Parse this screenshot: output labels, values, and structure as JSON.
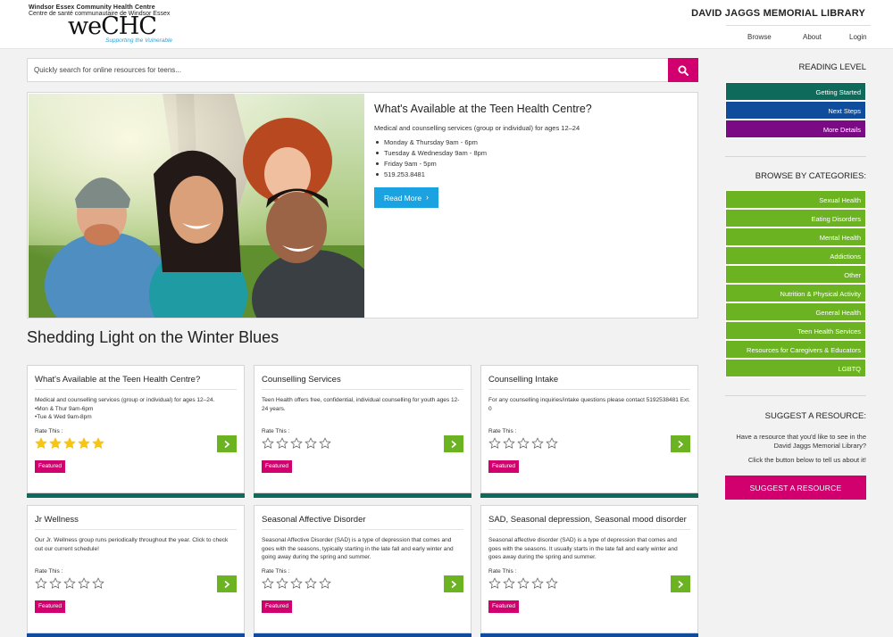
{
  "brand": {
    "org_line1": "Windsor Essex Community Health Centre",
    "org_line2": "Centre de santé communautaire de Windsor Essex",
    "logo_text": "weCHC",
    "tagline": "Supporting the Vulnerable"
  },
  "header": {
    "library_title": "DAVID JAGGS MEMORIAL LIBRARY",
    "nav": [
      "Browse",
      "About",
      "Login"
    ]
  },
  "search": {
    "placeholder": "Quickly search for online resources for teens..."
  },
  "hero": {
    "title": "What's Available at the Teen Health Centre?",
    "description": "Medical and counselling services (group or individual) for ages 12–24",
    "hours": [
      "Monday & Thursday 9am - 6pm",
      "Tuesday & Wednesday 9am - 8pm",
      "Friday 9am - 5pm",
      "519.253.8481"
    ],
    "button_label": "Read More",
    "image_description": "Four smiling young friends posing together outdoors"
  },
  "section_title": "Shedding Light on the Winter Blues",
  "cards": [
    {
      "title": "What's Available at the Teen Health Centre?",
      "body": [
        "Medical and counselling services (group or individual) for ages 12–24.",
        "•Mon & Thur 9am-6pm",
        "•Tue & Wed 9am-8pm"
      ],
      "rate_label": "Rate This :",
      "rating": 5,
      "badge": "Featured",
      "bar_color": "#0e6b5b"
    },
    {
      "title": "Counselling Services",
      "body": [
        "Teen Health offers free, confidential, individual counselling for youth ages 12-24 years."
      ],
      "rate_label": "Rate This :",
      "rating": 0,
      "badge": "Featured",
      "bar_color": "#0e6b5b"
    },
    {
      "title": "Counselling Intake",
      "body": [
        "For any counselling inquiries/intake questions please contact 5192538481 Ext. 0"
      ],
      "rate_label": "Rate This :",
      "rating": 0,
      "badge": "Featured",
      "bar_color": "#0e6b5b"
    },
    {
      "title": "Jr Wellness",
      "body": [
        "Our Jr. Wellness group runs periodically throughout the year. Click to check out our current schedule!"
      ],
      "rate_label": "Rate This :",
      "rating": 0,
      "badge": "Featured",
      "bar_color": "#0f4c9c"
    },
    {
      "title": "Seasonal Affective Disorder",
      "body": [
        "Seasonal Affective Disorder (SAD) is a type of depression that comes and goes with the seasons, typically starting in the late fall and early winter and going away during the spring and summer."
      ],
      "rate_label": "Rate This :",
      "rating": 0,
      "badge": "Featured",
      "bar_color": "#0f4c9c"
    },
    {
      "title": "SAD, Seasonal depression, Seasonal mood disorder",
      "body": [
        "Seasonal affective disorder (SAD) is a type of depression that comes and goes with the seasons. It usually starts in the late fall and early winter and goes away during the spring and summer."
      ],
      "rate_label": "Rate This :",
      "rating": 0,
      "badge": "Featured",
      "bar_color": "#0f4c9c"
    }
  ],
  "sidebar": {
    "reading_level_heading": "READING LEVEL",
    "reading_levels": [
      {
        "label": "Getting Started",
        "color": "#0e6b5b"
      },
      {
        "label": "Next Steps",
        "color": "#0f4c9c"
      },
      {
        "label": "More Details",
        "color": "#7b0b84"
      }
    ],
    "categories_heading": "BROWSE BY CATEGORIES:",
    "categories": [
      "Sexual Health",
      "Eating Disorders",
      "Mental Health",
      "Addictions",
      "Other",
      "Nutrition & Physical Activity",
      "General Health",
      "Teen Health Services",
      "Resources for Caregivers & Educators",
      "LGBTQ"
    ],
    "category_color": "#6cb321",
    "suggest_heading": "SUGGEST A RESOURCE:",
    "suggest_text": [
      "Have a resource that you'd like to see in the",
      "David Jaggs Memorial Library?"
    ],
    "suggest_cta_text": "Click the button below to tell us about it!",
    "suggest_button": "SUGGEST A RESOURCE"
  },
  "colors": {
    "accent": "#d1006e",
    "link_blue": "#1aa3e0",
    "green": "#6cb321",
    "star": "#f5c518"
  }
}
